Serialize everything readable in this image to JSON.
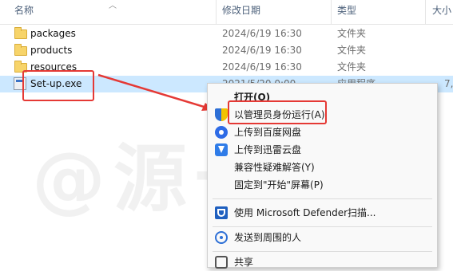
{
  "watermark": "@源一风",
  "columns": {
    "name": "名称",
    "date": "修改日期",
    "type": "类型",
    "size": "大小"
  },
  "files": [
    {
      "name": "packages",
      "date": "2024/6/19 16:30",
      "type": "文件夹",
      "size": "",
      "icon": "folder-icon"
    },
    {
      "name": "products",
      "date": "2024/6/19 16:30",
      "type": "文件夹",
      "size": "",
      "icon": "folder-icon"
    },
    {
      "name": "resources",
      "date": "2024/6/19 16:30",
      "type": "文件夹",
      "size": "",
      "icon": "folder-icon"
    },
    {
      "name": "Set-up.exe",
      "date": "2021/5/20 0:00",
      "type": "应用程序",
      "size": "7,",
      "icon": "exe-icon",
      "selected": true
    }
  ],
  "context_menu": {
    "items": [
      {
        "label": "打开(O)",
        "icon": "",
        "bold": true
      },
      {
        "label": "以管理员身份运行(A)",
        "icon": "uac-shield-icon"
      },
      {
        "label": "上传到百度网盘",
        "icon": "baidu-netdisk-icon"
      },
      {
        "label": "上传到迅雷云盘",
        "icon": "xunlei-cloud-icon"
      },
      {
        "label": "兼容性疑难解答(Y)",
        "icon": ""
      },
      {
        "label": "固定到\"开始\"屏幕(P)",
        "icon": ""
      },
      {
        "label": "使用 Microsoft Defender扫描...",
        "icon": "defender-icon"
      },
      {
        "label": "发送到周围的人",
        "icon": "nearby-share-icon"
      },
      {
        "label": "共享",
        "icon": "share-icon"
      }
    ]
  },
  "colors": {
    "selection": "#cce8ff",
    "annotation": "#e53935",
    "header_text": "#4c607a"
  }
}
